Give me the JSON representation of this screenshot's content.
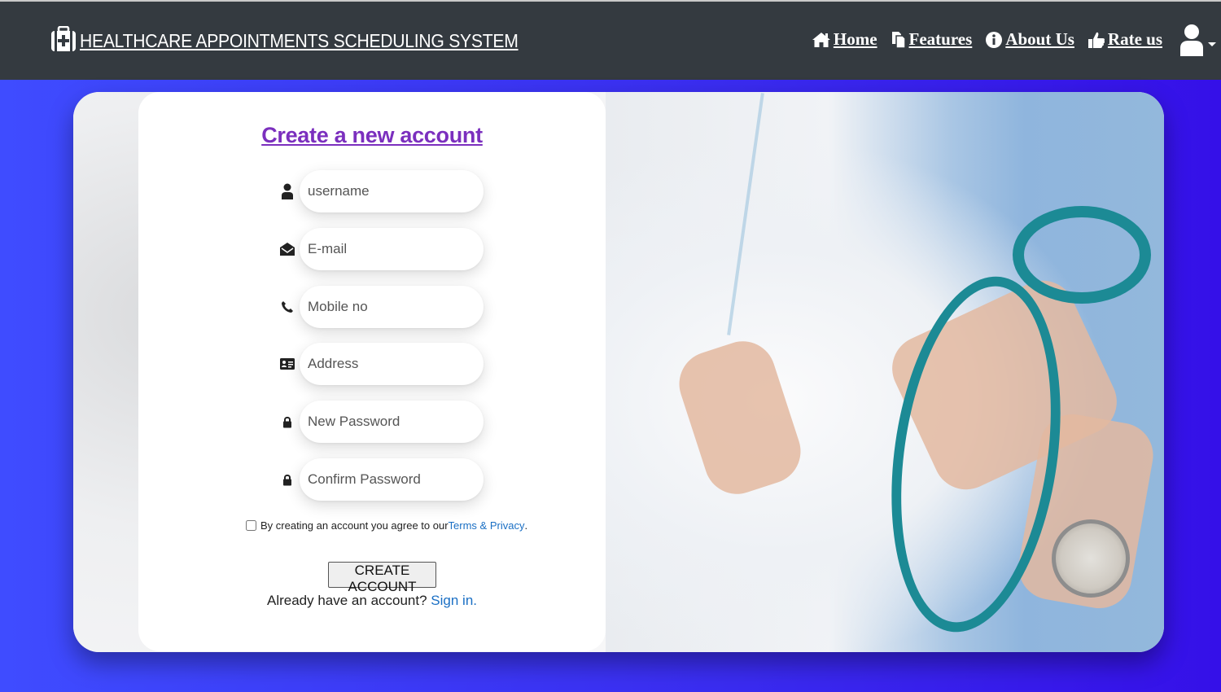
{
  "header": {
    "brand": "HEALTHCARE APPOINTMENTS SCHEDULING SYSTEM",
    "nav": [
      {
        "label": "Home",
        "icon": "home-icon"
      },
      {
        "label": "Features",
        "icon": "files-icon"
      },
      {
        "label": "About Us",
        "icon": "info-icon"
      },
      {
        "label": "Rate us",
        "icon": "thumbs-up-icon"
      }
    ],
    "user_icon": "user-icon"
  },
  "form": {
    "title": "Create a new account",
    "fields": [
      {
        "placeholder": "username",
        "icon": "user-icon"
      },
      {
        "placeholder": "E-mail",
        "icon": "envelope-open-icon"
      },
      {
        "placeholder": "Mobile no",
        "icon": "phone-icon"
      },
      {
        "placeholder": "Address",
        "icon": "address-card-icon"
      },
      {
        "placeholder": "New Password",
        "icon": "lock-icon"
      },
      {
        "placeholder": "Confirm Password",
        "icon": "lock-icon"
      }
    ],
    "agree_text": "By creating an account you agree to our",
    "agree_link": "Terms & Privacy",
    "agree_end": ".",
    "submit": "CREATE ACCOUNT",
    "signin_text": "Already have an account? ",
    "signin_link": "Sign in",
    "signin_end": "."
  },
  "colors": {
    "navbar": "#343a40",
    "background": "#3a2cf0",
    "title": "#7b2fbe",
    "link": "#1a6fc4"
  }
}
